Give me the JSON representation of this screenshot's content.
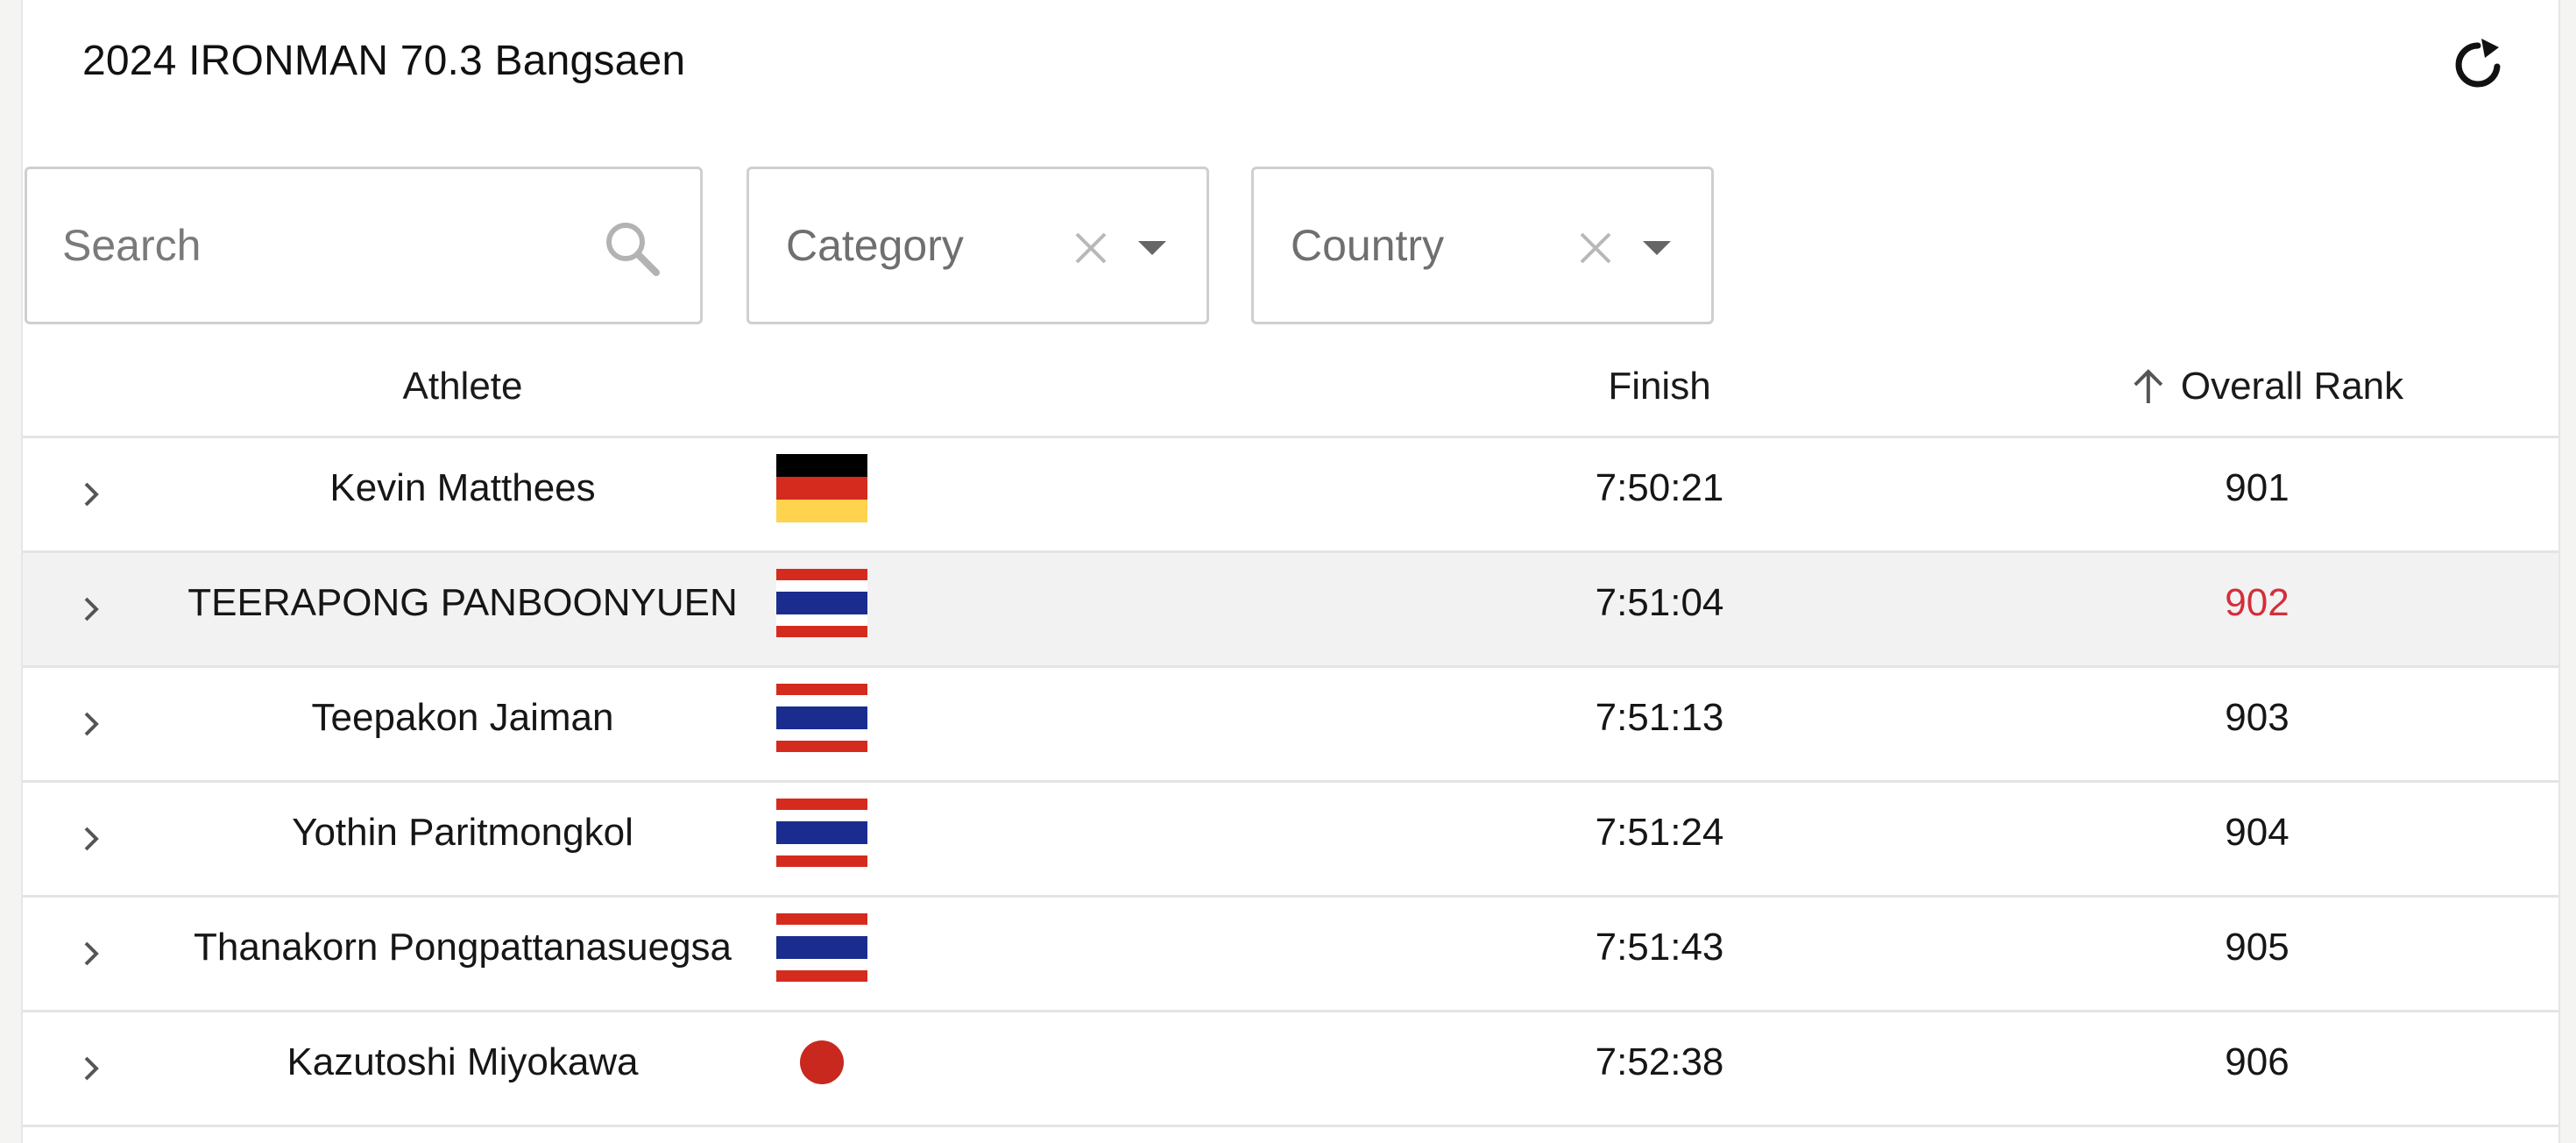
{
  "header": {
    "title": "2024 IRONMAN 70.3 Bangsaen",
    "refresh_icon": "refresh-icon"
  },
  "filters": {
    "search": {
      "placeholder": "Search",
      "value": "",
      "icon": "search-icon"
    },
    "category": {
      "placeholder": "Category",
      "clear_icon": "close-icon",
      "caret_icon": "caret-down-icon"
    },
    "country": {
      "placeholder": "Country",
      "clear_icon": "close-icon",
      "caret_icon": "caret-down-icon"
    }
  },
  "table": {
    "columns": {
      "athlete": "Athlete",
      "finish": "Finish",
      "overall_rank": "Overall Rank",
      "sort_icon": "arrow-up-icon"
    },
    "rows": [
      {
        "name": "Kevin Matthees",
        "flag": "germany-flag-icon",
        "finish": "7:50:21",
        "rank": "901"
      },
      {
        "name": "TEERAPONG PANBOONYUEN",
        "flag": "thailand-flag-icon",
        "finish": "7:51:04",
        "rank": "902",
        "highlight": true
      },
      {
        "name": "Teepakon Jaiman",
        "flag": "thailand-flag-icon",
        "finish": "7:51:13",
        "rank": "903"
      },
      {
        "name": "Yothin Paritmongkol",
        "flag": "thailand-flag-icon",
        "finish": "7:51:24",
        "rank": "904"
      },
      {
        "name": "Thanakorn Pongpattanasuegsa",
        "flag": "thailand-flag-icon",
        "finish": "7:51:43",
        "rank": "905"
      },
      {
        "name": "Kazutoshi Miyokawa",
        "flag": "japan-flag-icon",
        "finish": "7:52:38",
        "rank": "906"
      }
    ]
  },
  "colors": {
    "highlight_rank": "#d32f3a",
    "row_alt": "#f2f2f2",
    "border": "#e4e4e4"
  }
}
